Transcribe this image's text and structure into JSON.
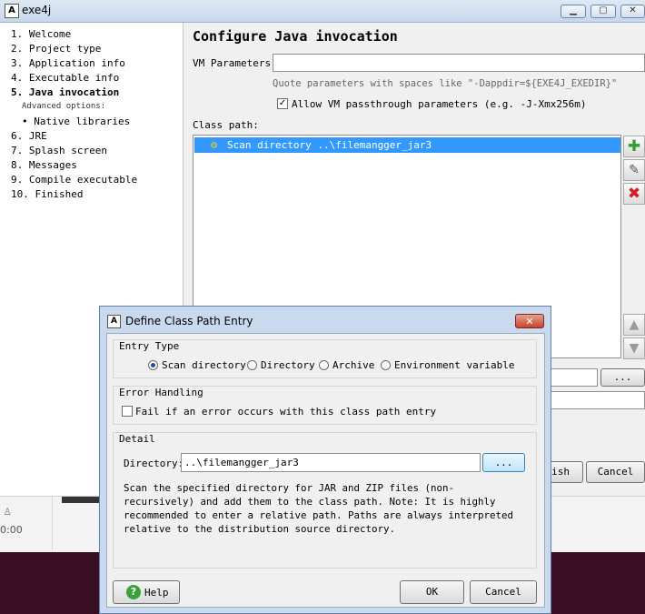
{
  "window": {
    "title": "exe4j",
    "app_icon": "A"
  },
  "steps": [
    {
      "label": "1. Welcome"
    },
    {
      "label": "2. Project type"
    },
    {
      "label": "3. Application info"
    },
    {
      "label": "4. Executable info"
    },
    {
      "label": "5. Java invocation"
    },
    {
      "label": "6. JRE"
    },
    {
      "label": "7. Splash screen"
    },
    {
      "label": "8. Messages"
    },
    {
      "label": "9. Compile executable"
    },
    {
      "label": "10. Finished"
    }
  ],
  "advanced_label": "Advanced options:",
  "advanced_items": [
    {
      "label": "• Native libraries"
    }
  ],
  "page": {
    "heading": "Configure Java invocation",
    "vm_label": "VM Parameters:",
    "vm_value": "",
    "vm_hint": "Quote parameters with spaces like \"-Dappdir=${EXE4J_EXEDIR}\"",
    "allow_vm_label": "Allow VM passthrough parameters (e.g. -J-Xmx256m)",
    "allow_vm_checked": true,
    "classpath_label": "Class path:",
    "classpath_entries": [
      {
        "label": "Scan directory ..\\filemangger_jar3"
      }
    ],
    "browse_label": "...",
    "finish_label": "ish",
    "cancel_label": "Cancel"
  },
  "bottom": {
    "time": "0:00"
  },
  "dialog": {
    "title": "Define Class Path Entry",
    "entry_type_label": "Entry Type",
    "entry_types": [
      {
        "label": "Scan directory",
        "selected": true
      },
      {
        "label": "Directory",
        "selected": false
      },
      {
        "label": "Archive",
        "selected": false
      },
      {
        "label": "Environment variable",
        "selected": false
      }
    ],
    "error_handling_label": "Error Handling",
    "fail_label": "Fail if an error occurs with this class path entry",
    "fail_checked": false,
    "detail_label": "Detail",
    "directory_label": "Directory:",
    "directory_value": "..\\filemangger_jar3",
    "browse_label": "...",
    "description": "Scan the specified directory for JAR and ZIP files (non-recursively) and add them to the class path. Note: It is highly recommended to enter a relative path. Paths are always interpreted relative to the distribution source directory.",
    "help_label": "Help",
    "ok_label": "OK",
    "cancel_label": "Cancel"
  },
  "colors": {
    "selection": "#3399ff",
    "add": "#2e9e2e",
    "remove": "#d42020",
    "dialog_frame": "#c9d9ee"
  }
}
